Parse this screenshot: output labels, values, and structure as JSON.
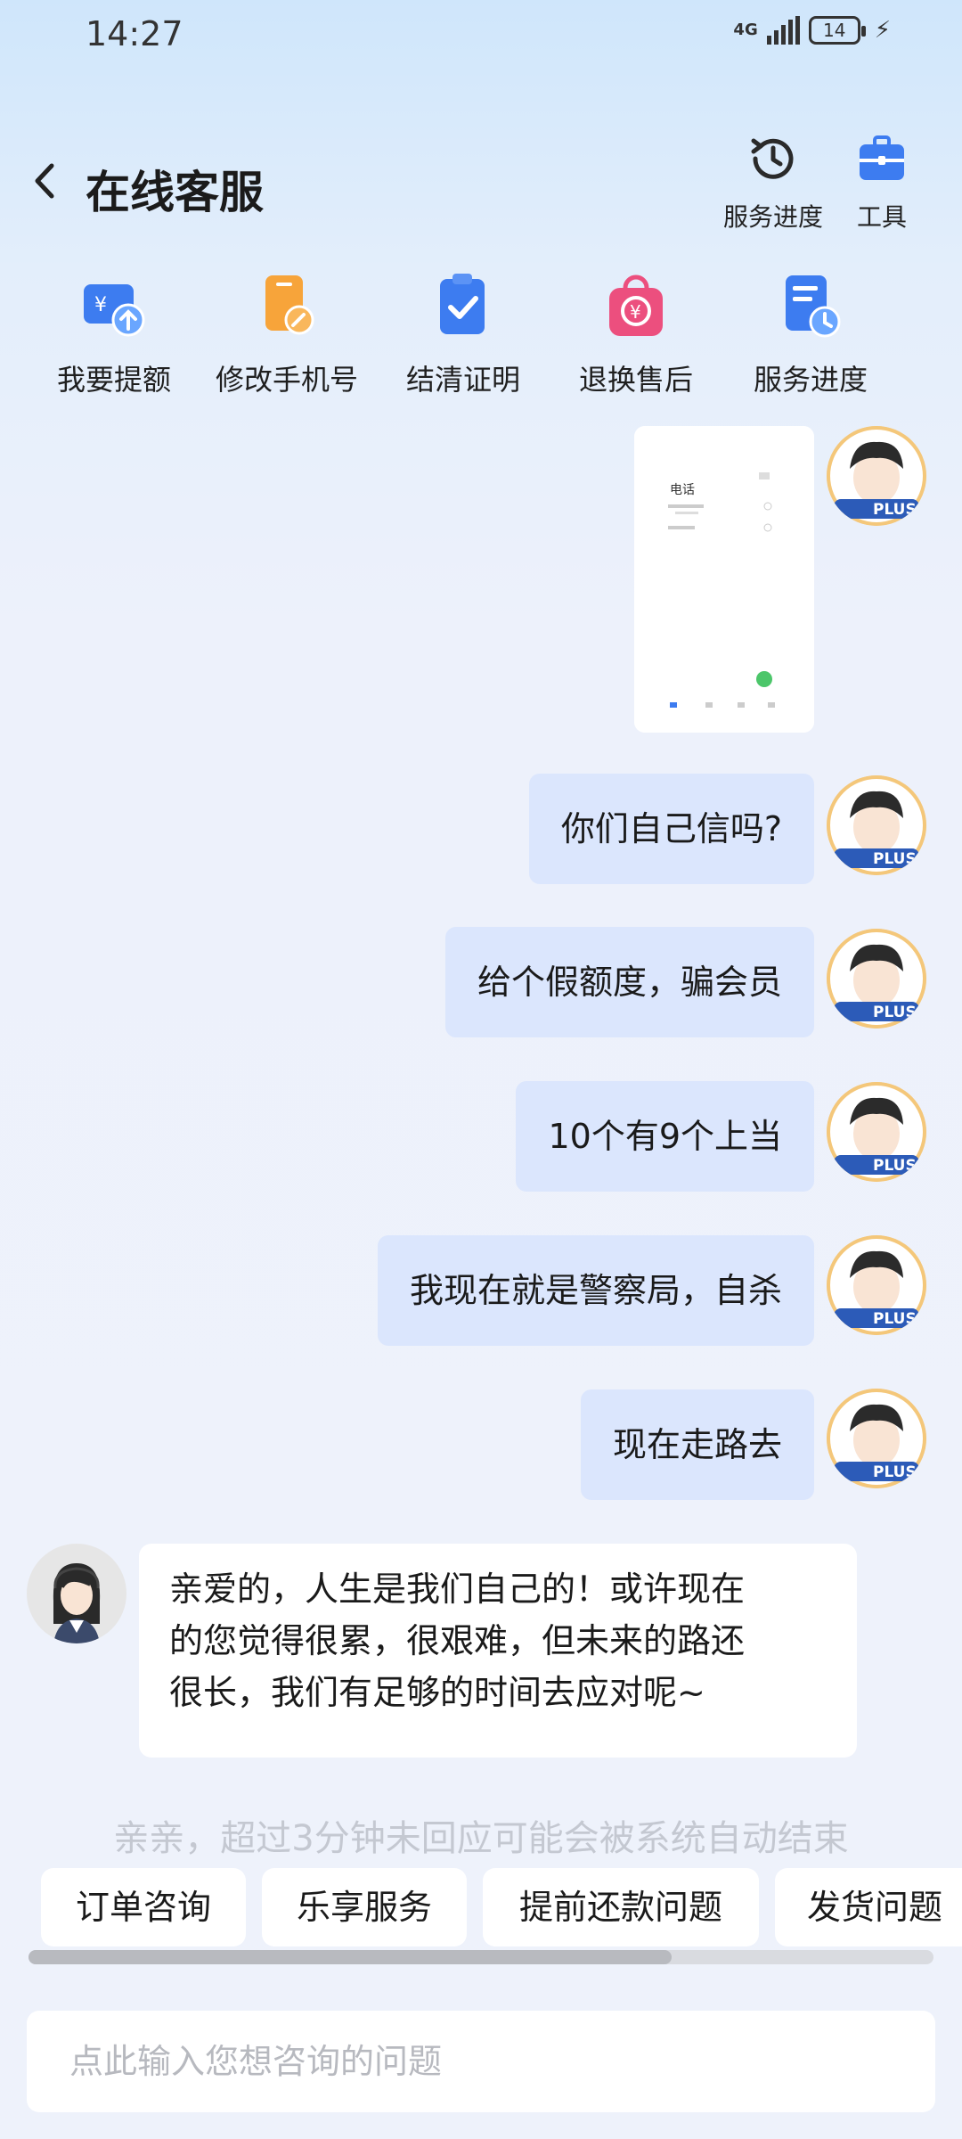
{
  "status_bar": {
    "time": "14:27",
    "network": "4G",
    "battery": "14"
  },
  "header": {
    "title": "在线客服",
    "progress_label": "服务进度",
    "tools_label": "工具"
  },
  "quick_actions": [
    {
      "label": "我要提额",
      "icon": "wallet-up-icon"
    },
    {
      "label": "修改手机号",
      "icon": "phone-edit-icon"
    },
    {
      "label": "结清证明",
      "icon": "clipboard-check-icon"
    },
    {
      "label": "退换售后",
      "icon": "shopping-bag-refund-icon"
    },
    {
      "label": "服务进度",
      "icon": "document-clock-icon"
    }
  ],
  "messages": {
    "screenshot_title": "电话",
    "user": [
      "你们自己信吗?",
      "给个假额度，骗会员",
      "10个有9个上当",
      "我现在就是警察局，自杀",
      "现在走路去"
    ],
    "agent": [
      "亲爱的，人生是我们自己的！或许现在",
      "的您觉得很累，很艰难，但未来的路还",
      "很长，我们有足够的时间去应对呢~"
    ],
    "avatar_badge": "PLUS"
  },
  "system_tip": "亲亲，超过3分钟未回应可能会被系统自动结束",
  "chips": [
    "订单咨询",
    "乐享服务",
    "提前还款问题",
    "发货问题"
  ],
  "input": {
    "placeholder": "点此输入您想咨询的问题",
    "value": ""
  },
  "colors": {
    "accent_blue": "#3d7cf0",
    "orange": "#f7a43a",
    "pink": "#ec4f7e",
    "bubble_out": "#dbe6fd"
  }
}
